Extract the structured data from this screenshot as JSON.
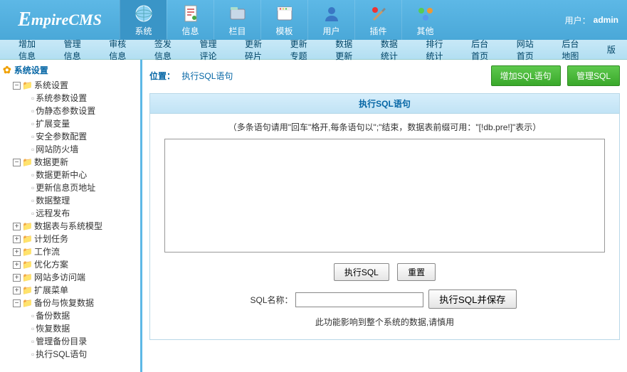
{
  "header": {
    "logo": "EmpireCMS",
    "user_label": "用户：",
    "user_name": "admin",
    "nav": [
      {
        "label": "系统",
        "icon": "globe",
        "active": true
      },
      {
        "label": "信息",
        "icon": "doc"
      },
      {
        "label": "栏目",
        "icon": "folder"
      },
      {
        "label": "模板",
        "icon": "window"
      },
      {
        "label": "用户",
        "icon": "user"
      },
      {
        "label": "插件",
        "icon": "tools"
      },
      {
        "label": "其他",
        "icon": "other"
      }
    ]
  },
  "subnav": [
    "增加信息",
    "管理信息",
    "审核信息",
    "签发信息",
    "管理评论",
    "更新碎片",
    "更新专题",
    "数据更新",
    "数据统计",
    "排行统计",
    "后台首页",
    "网站首页",
    "后台地图",
    "版"
  ],
  "sidebar": {
    "title": "系统设置",
    "tree": [
      {
        "label": "系统设置",
        "expand": "-",
        "children": [
          {
            "label": "系统参数设置"
          },
          {
            "label": "伪静态参数设置"
          },
          {
            "label": "扩展变量"
          },
          {
            "label": "安全参数配置"
          },
          {
            "label": "网站防火墙"
          }
        ]
      },
      {
        "label": "数据更新",
        "expand": "-",
        "children": [
          {
            "label": "数据更新中心"
          },
          {
            "label": "更新信息页地址"
          },
          {
            "label": "数据整理"
          },
          {
            "label": "远程发布"
          }
        ]
      },
      {
        "label": "数据表与系统模型",
        "expand": "+"
      },
      {
        "label": "计划任务",
        "expand": "+"
      },
      {
        "label": "工作流",
        "expand": "+"
      },
      {
        "label": "优化方案",
        "expand": "+"
      },
      {
        "label": "网站多访问端",
        "expand": "+"
      },
      {
        "label": "扩展菜单",
        "expand": "+"
      },
      {
        "label": "备份与恢复数据",
        "expand": "-",
        "children": [
          {
            "label": "备份数据"
          },
          {
            "label": "恢复数据"
          },
          {
            "label": "管理备份目录"
          },
          {
            "label": "执行SQL语句"
          }
        ]
      }
    ]
  },
  "main": {
    "breadcrumb_label": "位置：",
    "breadcrumb_page": "执行SQL语句",
    "btn_add": "增加SQL语句",
    "btn_manage": "管理SQL",
    "box_title": "执行SQL语句",
    "hint": "（多条语句请用\"回车\"格开,每条语句以\";\"结束，数据表前缀可用：\"[!db.pre!]\"表示）",
    "btn_run": "执行SQL",
    "btn_reset": "重置",
    "name_label": "SQL名称：",
    "btn_save": "执行SQL并保存",
    "warning": "此功能影响到整个系统的数据,请慎用"
  }
}
